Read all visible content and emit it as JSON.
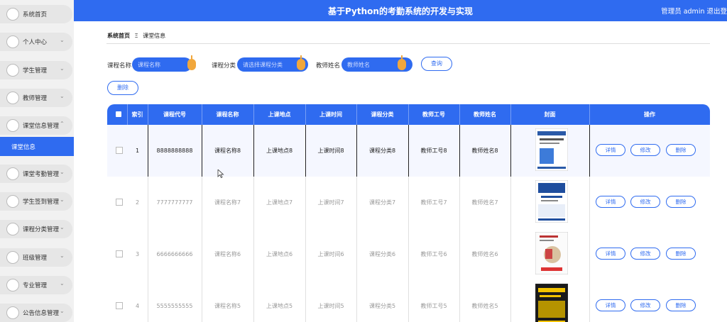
{
  "header": {
    "title": "基于Python的考勤系统的开发与实现",
    "user_text": "管理员 admin  退出登"
  },
  "sidebar": {
    "items": [
      {
        "label": "系统首页"
      },
      {
        "label": "个人中心"
      },
      {
        "label": "学生管理"
      },
      {
        "label": "教师管理"
      },
      {
        "label": "课堂信息管理"
      },
      {
        "label": "课堂考勤管理"
      },
      {
        "label": "学生签到管理"
      },
      {
        "label": "课程分类管理"
      },
      {
        "label": "班级管理"
      },
      {
        "label": "专业管理"
      },
      {
        "label": "公告信息管理"
      }
    ],
    "active_sub": "课堂信息"
  },
  "breadcrumb": {
    "home": "系统首页",
    "sep": "Ξ",
    "current": "课堂信息"
  },
  "search": {
    "course_name_label": "课程名称",
    "course_name_placeholder": "课程名称",
    "category_label": "课程分类",
    "category_placeholder": "请选择课程分类",
    "teacher_label": "教师姓名",
    "teacher_placeholder": "教师姓名",
    "query_button": "查询"
  },
  "delete_button": "删除",
  "table": {
    "headers": {
      "index": "索引",
      "code": "课程代号",
      "name": "课程名称",
      "location": "上课地点",
      "time": "上课时间",
      "category": "课程分类",
      "teacher_id": "教师工号",
      "teacher_name": "教师姓名",
      "cover": "封面",
      "actions": "操作"
    },
    "rows": [
      {
        "index": "1",
        "code": "8888888888",
        "name": "课程名称8",
        "location": "上课地点8",
        "time": "上课时间8",
        "category": "课程分类8",
        "teacher_id": "教师工号8",
        "teacher_name": "教师姓名8"
      },
      {
        "index": "2",
        "code": "7777777777",
        "name": "课程名称7",
        "location": "上课地点7",
        "time": "上课时间7",
        "category": "课程分类7",
        "teacher_id": "教师工号7",
        "teacher_name": "教师姓名7"
      },
      {
        "index": "3",
        "code": "6666666666",
        "name": "课程名称6",
        "location": "上课地点6",
        "time": "上课时间6",
        "category": "课程分类6",
        "teacher_id": "教师工号6",
        "teacher_name": "教师姓名6"
      },
      {
        "index": "4",
        "code": "5555555555",
        "name": "课程名称5",
        "location": "上课地点5",
        "time": "上课时间5",
        "category": "课程分类5",
        "teacher_id": "教师工号5",
        "teacher_name": "教师姓名5"
      }
    ],
    "actions": {
      "detail": "详情",
      "edit": "修改",
      "delete": "删除"
    }
  },
  "colors": {
    "primary": "#2f6bf0",
    "accent": "#f1a73c"
  }
}
